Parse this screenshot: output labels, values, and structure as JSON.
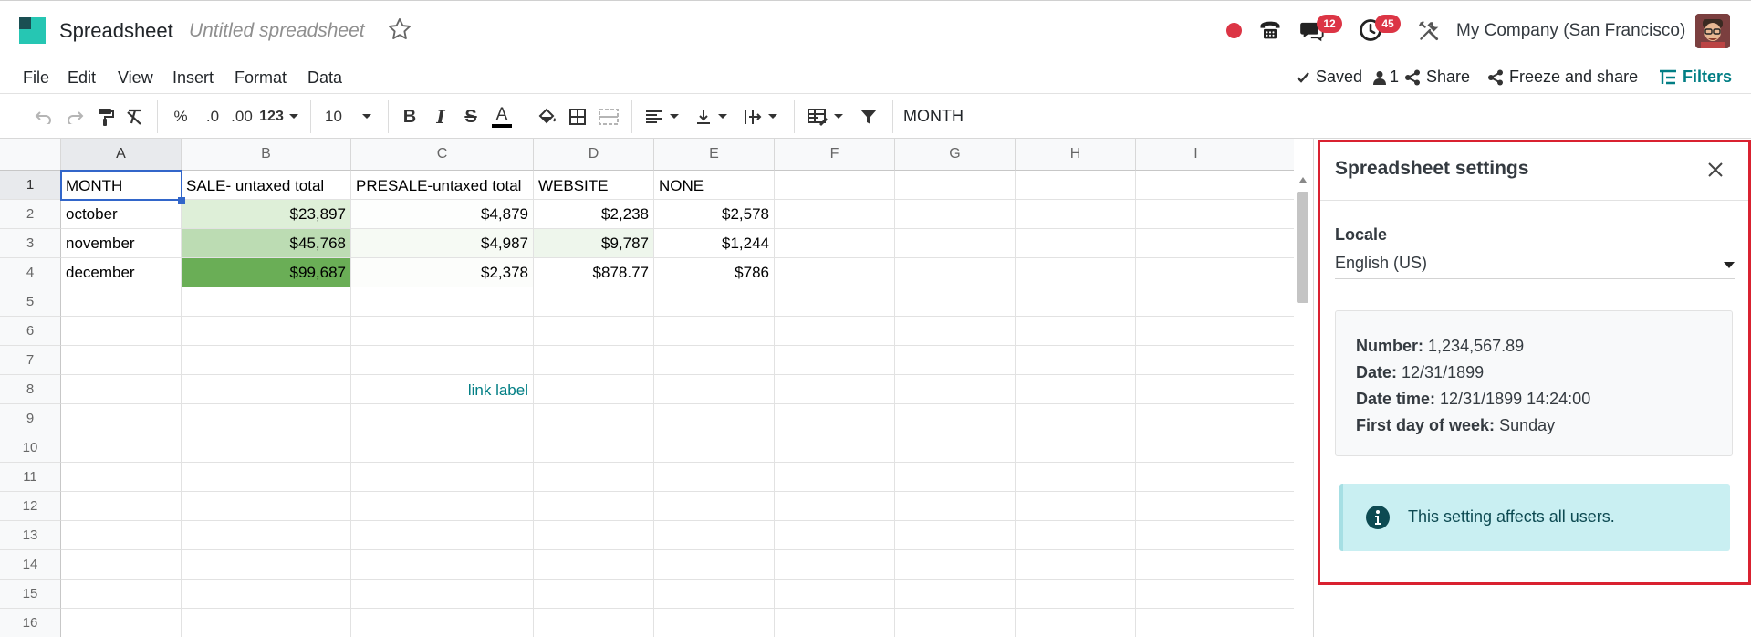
{
  "navbar": {
    "app_name": "Spreadsheet",
    "doc_name": "Untitled spreadsheet",
    "messages_count": "12",
    "activities_count": "45",
    "company": "My Company (San Francisco)"
  },
  "menu": {
    "items": [
      "File",
      "Edit",
      "View",
      "Insert",
      "Format",
      "Data"
    ],
    "saved": "Saved",
    "users_count": "1",
    "share": "Share",
    "freeze_share": "Freeze and share",
    "filters": "Filters"
  },
  "toolbar": {
    "percent": "%",
    "dec_decrease": ".0",
    "dec_increase": ".00",
    "number_format": "123",
    "font_size": "10",
    "bold": "B",
    "italic": "I",
    "strike": "S",
    "text_color_glyph": "A",
    "formula_value": "MONTH"
  },
  "grid": {
    "columns": [
      "A",
      "B",
      "C",
      "D",
      "E",
      "F",
      "G",
      "H",
      "I"
    ],
    "rows": [
      "1",
      "2",
      "3",
      "4",
      "5",
      "6",
      "7",
      "8",
      "9",
      "10",
      "11",
      "12",
      "13",
      "14",
      "15",
      "16"
    ],
    "cells": {
      "A1": "MONTH",
      "B1": "SALE- untaxed total",
      "C1": "PRESALE-untaxed total",
      "D1": "WEBSITE",
      "E1": "NONE",
      "A2": "october",
      "B2": "$23,897",
      "C2": "$4,879",
      "D2": "$2,238",
      "E2": "$2,578",
      "A3": "november",
      "B3": "$45,768",
      "C3": "$4,987",
      "D3": "$9,787",
      "E3": "$1,244",
      "A4": "december",
      "B4": "$99,687",
      "C4": "$2,378",
      "D4": "$878.77",
      "E4": "$786",
      "C8": "link label"
    },
    "selected_cell": "A1",
    "colors": {
      "B2": "#deefd8",
      "B3": "#bcdcb3",
      "B4": "#6aae56",
      "C2": "#fdfefd",
      "C3": "#f6faf4",
      "C4": "#fcfdfb",
      "D3": "#eef6ec",
      "link": "#017e84"
    }
  },
  "settings_panel": {
    "title": "Spreadsheet settings",
    "locale_label": "Locale",
    "locale_value": "English (US)",
    "number_label": "Number:",
    "number_value": "1,234,567.89",
    "date_label": "Date:",
    "date_value": "12/31/1899",
    "datetime_label": "Date time:",
    "datetime_value": "12/31/1899 14:24:00",
    "first_day_label": "First day of week:",
    "first_day_value": "Sunday",
    "alert_text": "This setting affects all users.",
    "highlight_color": "#d92130"
  }
}
